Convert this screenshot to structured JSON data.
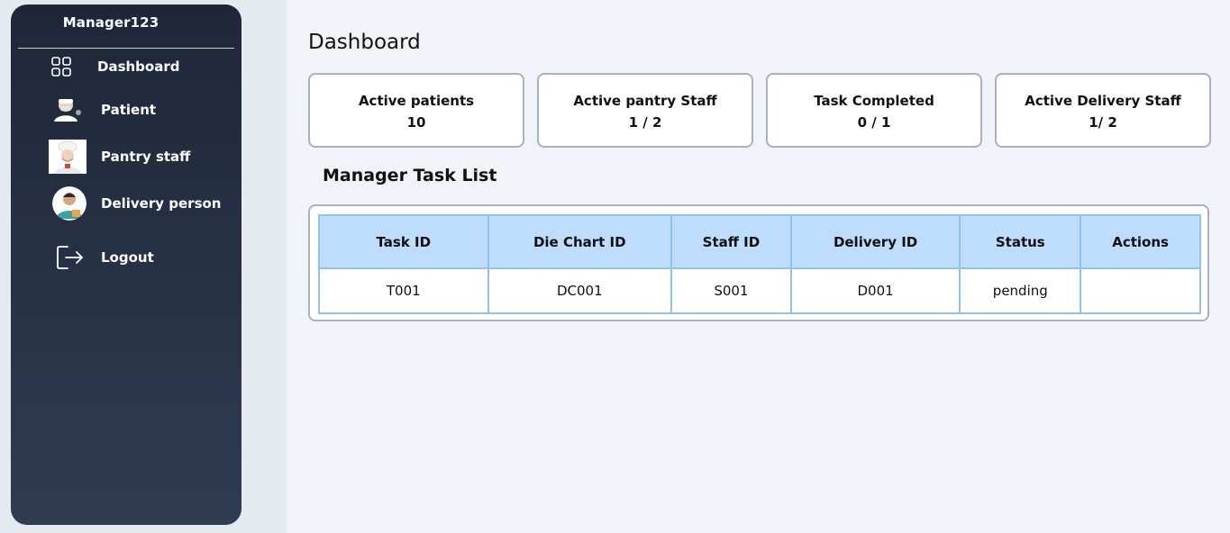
{
  "sidebar": {
    "username": "Manager123",
    "items": [
      {
        "label": "Dashboard",
        "icon": "dashboard-grid-icon"
      },
      {
        "label": "Patient",
        "icon": "patient-avatar-icon"
      },
      {
        "label": "Pantry staff",
        "icon": "chef-avatar-icon"
      },
      {
        "label": "Delivery person",
        "icon": "delivery-person-avatar-icon"
      },
      {
        "label": "Logout",
        "icon": "logout-icon"
      }
    ]
  },
  "main": {
    "title": "Dashboard",
    "cards": [
      {
        "title": "Active patients",
        "value": "10"
      },
      {
        "title": "Active pantry Staff",
        "value": "1 / 2"
      },
      {
        "title": "Task Completed",
        "value": "0 / 1"
      },
      {
        "title": "Active Delivery Staff",
        "value": "1/ 2"
      }
    ],
    "task_list": {
      "title": "Manager Task List",
      "columns": [
        "Task ID",
        "Die Chart ID",
        "Staff ID",
        "Delivery ID",
        "Status",
        "Actions"
      ],
      "rows": [
        [
          "T001",
          "DC001",
          "S001",
          "D001",
          "pending",
          ""
        ]
      ]
    }
  },
  "colors": {
    "sidebar_top": "#1f2638",
    "sidebar_bottom": "#2f3c52",
    "table_header": "#bedcfb",
    "table_border": "#8fc2ee",
    "page_bg": "#f0f3f8"
  }
}
